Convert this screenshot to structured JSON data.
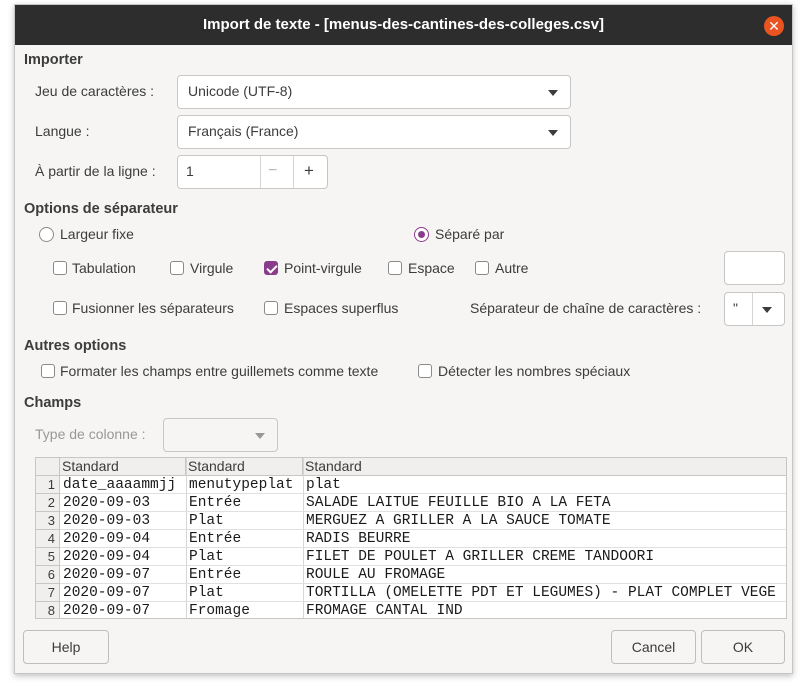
{
  "window": {
    "title": "Import de texte - [menus-des-cantines-des-colleges.csv]"
  },
  "importer": {
    "heading": "Importer",
    "charset_label": "Jeu de caractères :",
    "charset_value": "Unicode (UTF-8)",
    "language_label": "Langue :",
    "language_value": "Français (France)",
    "from_row_label": "À partir de la ligne :",
    "from_row_value": "1",
    "minus": "−",
    "plus": "+"
  },
  "separator": {
    "heading": "Options de séparateur",
    "fixed_width": "Largeur fixe",
    "separated_by": "Séparé par",
    "options": [
      {
        "label": "Tabulation",
        "checked": false
      },
      {
        "label": "Virgule",
        "checked": false
      },
      {
        "label": "Point-virgule",
        "checked": true
      },
      {
        "label": "Espace",
        "checked": false
      },
      {
        "label": "Autre",
        "checked": false
      }
    ],
    "merge_delimiters": "Fusionner les séparateurs",
    "trim_spaces": "Espaces superflus",
    "string_delimiter_label": "Séparateur de chaîne de caractères :",
    "string_delimiter_value": "\""
  },
  "other": {
    "heading": "Autres options",
    "quoted_as_text": "Formater les champs entre guillemets comme texte",
    "detect_special": "Détecter les nombres spéciaux"
  },
  "fields": {
    "heading": "Champs",
    "column_type_label": "Type de colonne :",
    "columns": [
      "Standard",
      "Standard",
      "Standard"
    ],
    "rows": [
      [
        "1",
        "date_aaaammjj",
        "menutypeplat",
        "plat"
      ],
      [
        "2",
        "2020-09-03",
        "Entrée",
        "SALADE LAITUE FEUILLE BIO A LA FETA"
      ],
      [
        "3",
        "2020-09-03",
        "Plat",
        "MERGUEZ A GRILLER A LA SAUCE TOMATE"
      ],
      [
        "4",
        "2020-09-04",
        "Entrée",
        "RADIS BEURRE"
      ],
      [
        "5",
        "2020-09-04",
        "Plat",
        "FILET DE POULET A GRILLER CREME TANDOORI"
      ],
      [
        "6",
        "2020-09-07",
        "Entrée",
        "ROULE AU FROMAGE"
      ],
      [
        "7",
        "2020-09-07",
        "Plat",
        "TORTILLA (OMELETTE PDT ET LEGUMES) - PLAT COMPLET VEGE"
      ],
      [
        "8",
        "2020-09-07",
        "Fromage",
        "FROMAGE CANTAL IND"
      ]
    ]
  },
  "buttons": {
    "help": "Help",
    "cancel": "Cancel",
    "ok": "OK"
  },
  "colors": {
    "accent": "#8a3c8c",
    "close": "#e95420",
    "titlebar": "#2d2d2d"
  }
}
